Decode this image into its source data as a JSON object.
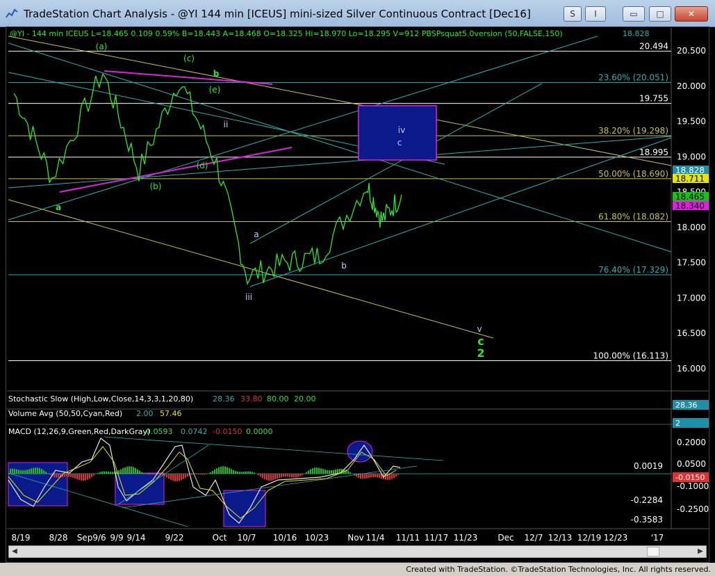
{
  "window": {
    "title": "TradeStation Chart Analysis - @YI 144 min [ICEUS] mini-sized Silver Continuous Contract [Dec16]",
    "btn_s": "S",
    "btn_i": "I",
    "btn_min": "▭",
    "btn_max": "□",
    "btn_close": "✕"
  },
  "header": {
    "symbol_line": "@YI - 144 min  ICEUS  L=18.465  0.109  0.59%   B=18.443  A=18.468  O=18.325  Hi=18.970  Lo=18.295  V=912  PBSPsquat5.0version (50,FALSE,150)",
    "last_value": "18.828"
  },
  "price_axis": {
    "labels": [
      "20.500",
      "20.000",
      "19.500",
      "19.000",
      "18.500",
      "18.000",
      "17.500",
      "17.000",
      "16.500",
      "16.000"
    ],
    "min": 15.85,
    "max": 20.75
  },
  "levels": [
    {
      "label": "20.494",
      "value": 20.494,
      "color": "#ffffff"
    },
    {
      "label": "23.60% (20.051)",
      "value": 20.051,
      "color": "#2bb0b0"
    },
    {
      "label": "19.755",
      "value": 19.755,
      "color": "#ffffff"
    },
    {
      "label": "38.20% (19.298)",
      "value": 19.298,
      "color": "#c9c34a"
    },
    {
      "label": "18.995",
      "value": 18.995,
      "color": "#ffffff"
    },
    {
      "label": "50.00% (18.690)",
      "value": 18.69,
      "color": "#c9c34a"
    },
    {
      "label": "61.80% (18.082)",
      "value": 18.082,
      "color": "#c9c34a"
    },
    {
      "label": "76.40% (17.329)",
      "value": 17.329,
      "color": "#2bb0b0"
    },
    {
      "label": "100.00% (16.113)",
      "value": 16.113,
      "color": "#ffffff"
    }
  ],
  "price_tags": [
    {
      "text": "18.828",
      "bg": "#1f8fa8",
      "fg": "#ffffff"
    },
    {
      "text": "18.711",
      "bg": "#e6e600",
      "fg": "#000000"
    },
    {
      "text": "18.465",
      "bg": "#18c018",
      "fg": "#000000"
    },
    {
      "text": "18.340",
      "bg": "#e020e0",
      "fg": "#000000"
    }
  ],
  "wave_labels": [
    {
      "text": "(a)",
      "color": "#2ee62e"
    },
    {
      "text": "(c)",
      "color": "#2ee62e"
    },
    {
      "text": "b",
      "color": "#2ee62e"
    },
    {
      "text": "(e)",
      "color": "#2ee62e"
    },
    {
      "text": "ii",
      "color": "#c8c8ff"
    },
    {
      "text": "(d)",
      "color": "#2ee62e"
    },
    {
      "text": "(b)",
      "color": "#2ee62e"
    },
    {
      "text": "a",
      "color": "#2ee62e"
    },
    {
      "text": "a",
      "color": "#c8c8ff"
    },
    {
      "text": "iii",
      "color": "#c8c8ff"
    },
    {
      "text": "b",
      "color": "#c8c8ff"
    },
    {
      "text": "iv",
      "color": "#c8c8ff"
    },
    {
      "text": "c",
      "color": "#c8c8ff"
    },
    {
      "text": "v",
      "color": "#c8c8ff"
    },
    {
      "text": "c",
      "color": "#2ee62e"
    },
    {
      "text": "2",
      "color": "#2ee62e"
    }
  ],
  "indicators": {
    "stoch_label": "Stochastic Slow (High,Low,Close,14,3,3,1,20,80)",
    "stoch_v1": "28.36",
    "stoch_v2": "33.80",
    "stoch_v3": "80.00",
    "stoch_v4": "20.00",
    "stoch_tag": "28.36",
    "vol_label": "Volume Avg (50,50,Cyan,Red)",
    "vol_v1": "2.00",
    "vol_v2": "57.46",
    "vol_tag": "2",
    "macd_label": "MACD (12,26,9,Green,Red,DarkGray)",
    "macd_v1": "0.0593",
    "macd_v2": "0.0742",
    "macd_v3": "-0.0150",
    "macd_v4": "0.0000",
    "macd_axis": [
      "0.2000",
      "0.0500",
      "-0.1000",
      "-0.2500"
    ],
    "macd_levels": [
      "0.0019",
      "-0.2284",
      "-0.3583"
    ],
    "macd_tag": "-0.0150"
  },
  "date_axis": [
    "8/19",
    "8/28",
    "Sep",
    "9/6",
    "9/9",
    "9/14",
    "9/22",
    "Oct",
    "10/7",
    "10/16",
    "10/23",
    "Nov",
    "11/4",
    "11/11",
    "11/17",
    "11/23",
    "Dec",
    "12/7",
    "12/13",
    "12/19",
    "12/23",
    "'17"
  ],
  "footer": {
    "text": "Created with TradeStation. ©TradeStation Technologies, Inc. All rights reserved."
  },
  "chart_data": {
    "type": "line",
    "x": [
      "8/19",
      "8/28",
      "9/6",
      "9/14",
      "9/22",
      "Oct",
      "10/7",
      "10/16",
      "10/23",
      "Nov",
      "11/4",
      "11/8"
    ],
    "series": [
      {
        "values": [
          19.9,
          18.7,
          20.2,
          18.8,
          20.1,
          18.9,
          17.3,
          17.5,
          17.6,
          18.6,
          18.1,
          18.465
        ]
      }
    ],
    "ylim": [
      15.85,
      20.75
    ]
  }
}
